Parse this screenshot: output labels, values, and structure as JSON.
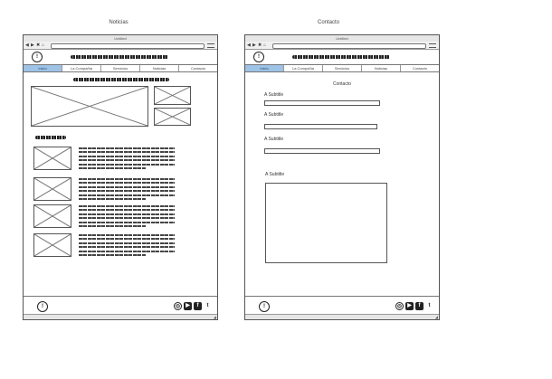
{
  "labels": {
    "left": "Noticias",
    "right": "Contacto"
  },
  "window": {
    "left_title": "Untitled",
    "right_title": "Untitled",
    "nav_symbols": [
      "◀",
      "▶",
      "✖",
      "⌂"
    ]
  },
  "nav": {
    "tabs": [
      "Inicio",
      "La Compañía",
      "Servicios",
      "Noticias",
      "Contacto"
    ]
  },
  "news": {},
  "contact": {
    "title": "Contacto",
    "subtitles": [
      "A Subtitle",
      "A Subtitle",
      "A Subtitle"
    ],
    "message_subtitle": "A Subtitle"
  },
  "footer": {
    "social_icons": [
      "instagram-icon",
      "youtube-icon",
      "facebook-icon",
      "twitter-icon"
    ]
  },
  "icon_glyphs": {
    "shield": "!",
    "instagram": "◎",
    "youtube": "▶",
    "facebook": "f",
    "twitter": "t",
    "resize": "◢"
  }
}
